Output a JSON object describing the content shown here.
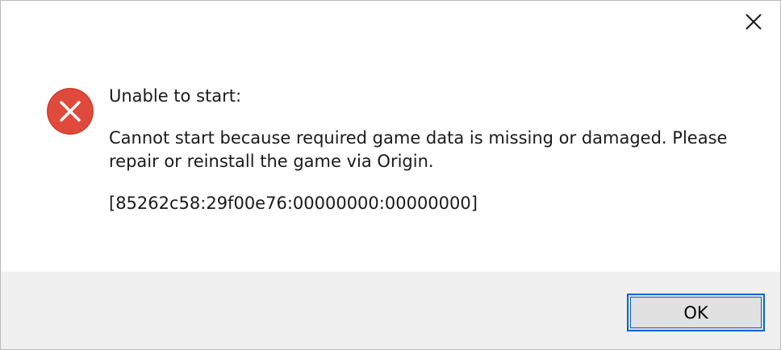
{
  "dialog": {
    "heading": "Unable to start:",
    "message": "Cannot start because required game data is missing or damaged. Please repair or reinstall the game via Origin.",
    "code": "[85262c58:29f00e76:00000000:00000000]",
    "ok_label": "OK",
    "icon": "error-x-circle-icon",
    "close_icon": "close-icon"
  },
  "colors": {
    "error_red": "#e04a3c",
    "button_focus": "#0a64d8",
    "footer_bg": "#f0f0f0"
  }
}
